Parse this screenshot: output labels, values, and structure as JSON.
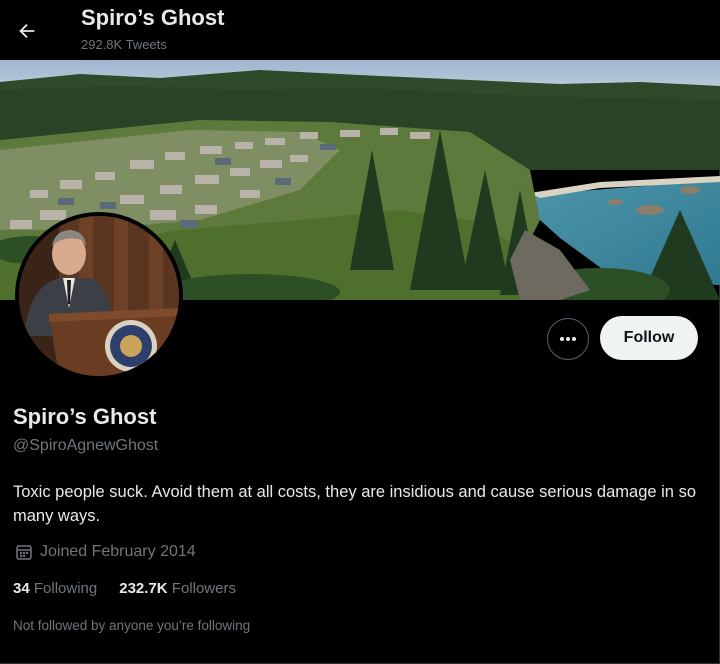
{
  "header": {
    "back_icon": "arrow-left-icon",
    "title": "Spiro’s Ghost",
    "tweet_count": "292.8K Tweets"
  },
  "banner": {
    "description_icon": "landscape-photo"
  },
  "profile": {
    "name": "Spiro’s Ghost",
    "handle": "@SpiroAgnewGhost",
    "bio": "Toxic people suck. Avoid them at all costs, they are insidious and cause serious damage in so many ways.",
    "joined": "Joined February 2014",
    "following_count": "34",
    "following_label": "Following",
    "followers_count": "232.7K",
    "followers_label": "Followers",
    "not_followed_text": "Not followed by anyone you’re following"
  },
  "actions": {
    "more_icon": "ellipsis-icon",
    "follow_label": "Follow"
  },
  "colors": {
    "background": "#000000",
    "primary_text": "#e7e9ea",
    "secondary_text": "#71767b",
    "follow_button_bg": "#eff3f4"
  }
}
